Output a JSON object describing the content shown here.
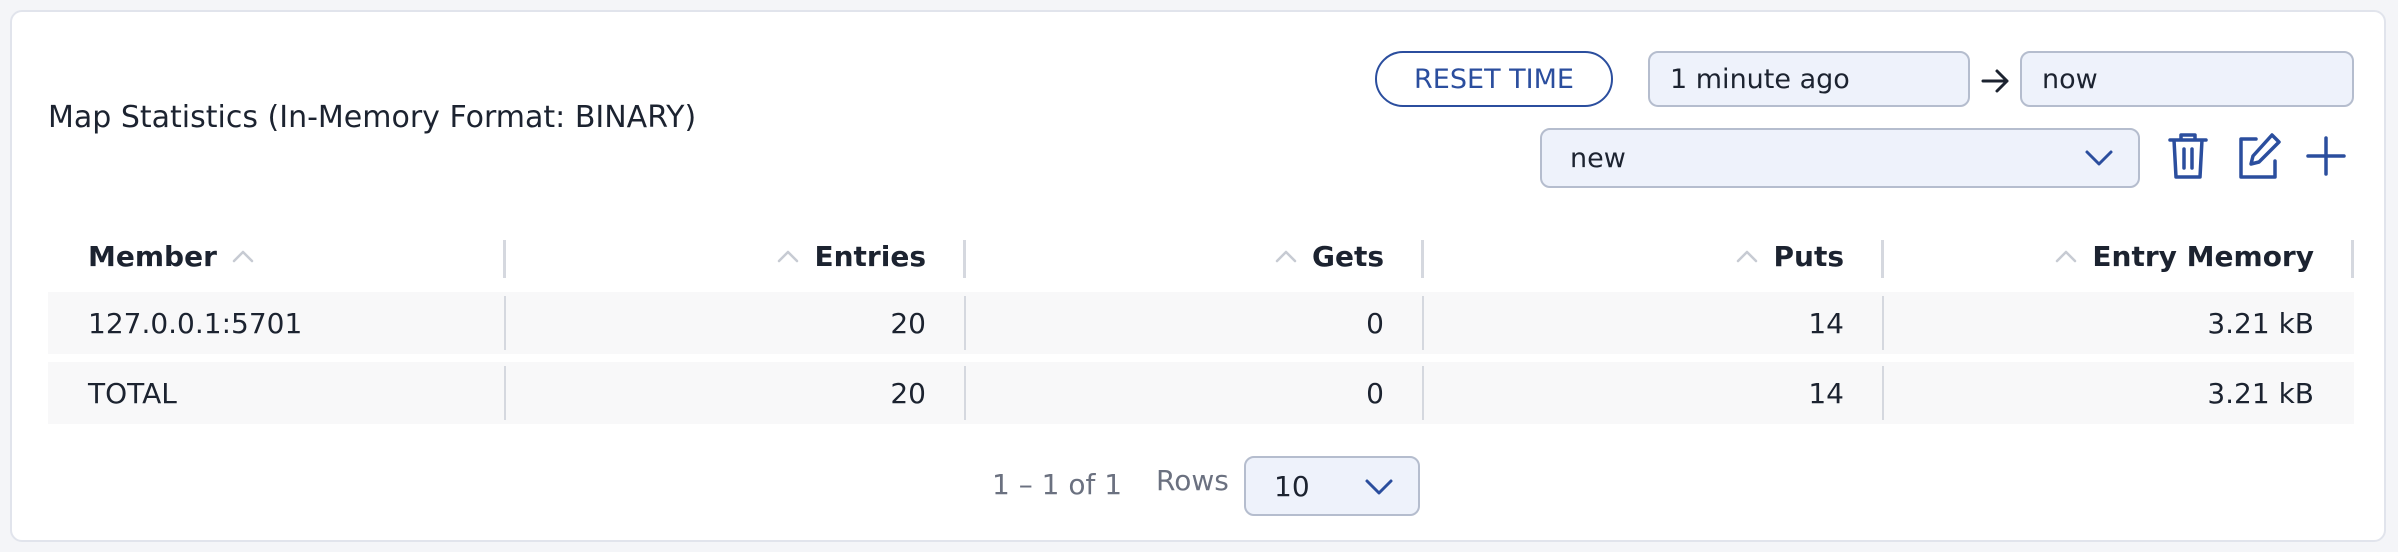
{
  "panel": {
    "title": "Map Statistics (In-Memory Format: BINARY)"
  },
  "time_controls": {
    "reset_label": "RESET TIME",
    "from_value": "1 minute ago",
    "to_value": "now"
  },
  "preset_select": {
    "value": "new"
  },
  "icons": {
    "arrow": "arrow-right-icon",
    "chevron": "chevron-down-icon",
    "trash": "trash-icon",
    "edit": "edit-icon",
    "add": "plus-icon",
    "sort": "sort-ascending-icon"
  },
  "table": {
    "columns": [
      "Member",
      "Entries",
      "Gets",
      "Puts",
      "Entry Memory"
    ],
    "rows": [
      [
        "127.0.0.1:5701",
        "20",
        "0",
        "14",
        "3.21 kB"
      ],
      [
        "TOTAL",
        "20",
        "0",
        "14",
        "3.21 kB"
      ]
    ]
  },
  "pagination": {
    "range": "1 – 1 of 1",
    "rows_label": "Rows",
    "rows_value": "10"
  },
  "colors": {
    "accent": "#2b4e9e",
    "input_bg": "#eef2fb",
    "row_bg": "#f8f8f9"
  }
}
